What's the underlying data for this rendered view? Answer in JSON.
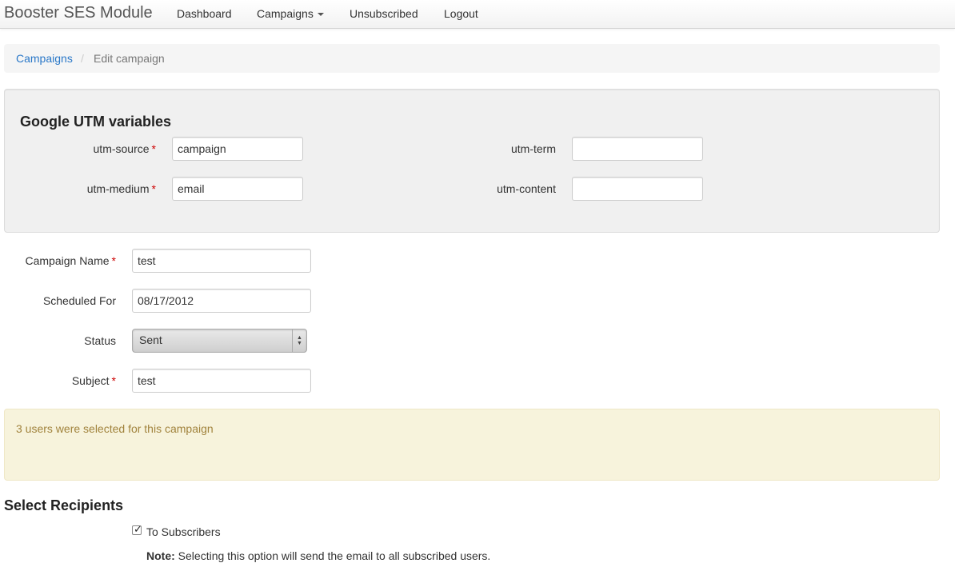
{
  "navbar": {
    "brand": "Booster SES Module",
    "items": [
      {
        "label": "Dashboard"
      },
      {
        "label": "Campaigns"
      },
      {
        "label": "Unsubscribed"
      },
      {
        "label": "Logout"
      }
    ]
  },
  "breadcrumb": {
    "link": "Campaigns",
    "separator": "/",
    "active": "Edit campaign"
  },
  "utm": {
    "title": "Google UTM variables",
    "source_label": "utm-source",
    "source_value": "campaign",
    "medium_label": "utm-medium",
    "medium_value": "email",
    "term_label": "utm-term",
    "term_value": "",
    "content_label": "utm-content",
    "content_value": ""
  },
  "form": {
    "required_mark": "*",
    "campaign_name_label": "Campaign Name",
    "campaign_name_value": "test",
    "scheduled_label": "Scheduled For",
    "scheduled_value": "08/17/2012",
    "status_label": "Status",
    "status_value": "Sent",
    "subject_label": "Subject",
    "subject_value": "test"
  },
  "alert": {
    "text": "3 users were selected for this campaign",
    "color": "#a1833d"
  },
  "recipients": {
    "title": "Select Recipients",
    "checkbox_checked": true,
    "checkbox_label": "To Subscribers",
    "note_prefix": "Note:",
    "note_text": "Selecting this option will send the email to all subscribed users."
  },
  "colors": {
    "link": "#2a78c8",
    "required": "#cc0000"
  }
}
